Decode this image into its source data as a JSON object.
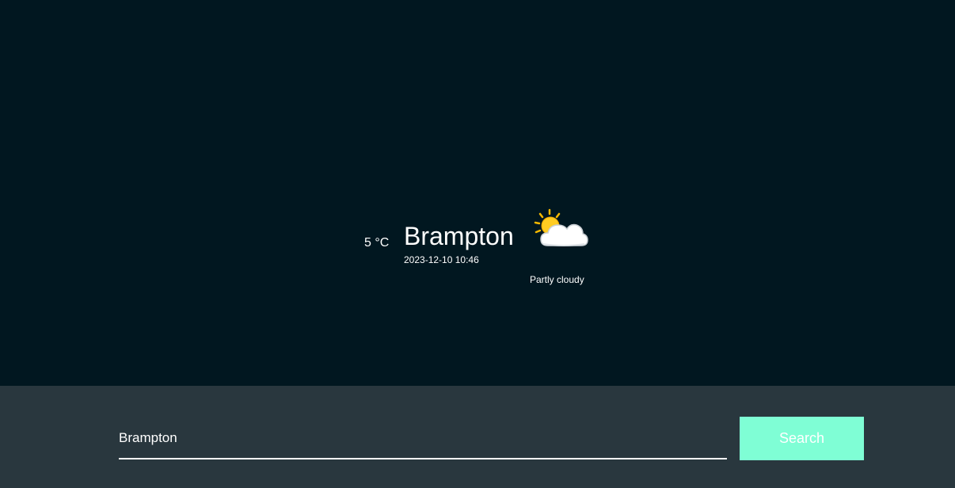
{
  "weather": {
    "temperature": "5 °C",
    "city": "Brampton",
    "datetime": "2023-12-10 10:46",
    "condition": "Partly cloudy",
    "icon": "partly-cloudy-icon"
  },
  "search": {
    "value": "Brampton",
    "button_label": "Search"
  },
  "colors": {
    "background": "#011720",
    "search_bar": "#29373e",
    "accent": "#7ffed5"
  }
}
